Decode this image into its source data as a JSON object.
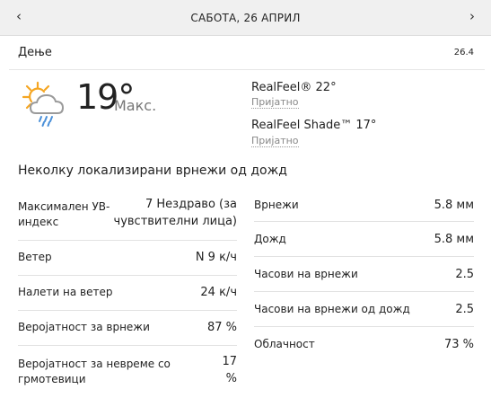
{
  "header": {
    "title": "САБОТА, 26 АПРИЛ",
    "prev_icon": "chevron-left-icon",
    "next_icon": "chevron-right-icon",
    "prev_glyph": "‹",
    "next_glyph": "›"
  },
  "day_bar": {
    "label": "Дење",
    "date": "26.4"
  },
  "current": {
    "icon": "sun-cloud-rain-icon",
    "temperature": "19°",
    "max_label": "Макс.",
    "realfeel": "RealFeel® 22°",
    "realfeel_desc": "Пријатно",
    "realfeel_shade": "RealFeel Shade™ 17°",
    "realfeel_shade_desc": "Пријатно"
  },
  "phrase": "Неколку локализирани врнежи од дожд",
  "left_details": [
    {
      "label": "Максимален УВ-индекс",
      "value": "7 Нездраво (за чувствителни лица)"
    },
    {
      "label": "Ветер",
      "value": "N 9 к/ч"
    },
    {
      "label": "Налети на ветер",
      "value": "24 к/ч"
    },
    {
      "label": "Веројатност за врнежи",
      "value": "87 %"
    },
    {
      "label": "Веројатност за невреме со грмотевици",
      "value": "17 %"
    }
  ],
  "right_details": [
    {
      "label": "Врнежи",
      "value": "5.8 мм"
    },
    {
      "label": "Дожд",
      "value": "5.8 мм"
    },
    {
      "label": "Часови на врнежи",
      "value": "2.5"
    },
    {
      "label": "Часови на врнежи од дожд",
      "value": "2.5"
    },
    {
      "label": "Облачност",
      "value": "73 %"
    }
  ],
  "colors": {
    "sun": "#f5a623",
    "cloud_outline": "#9a9a9a",
    "rain": "#4a90d9",
    "topbar_bg": "#f0f0f0"
  }
}
